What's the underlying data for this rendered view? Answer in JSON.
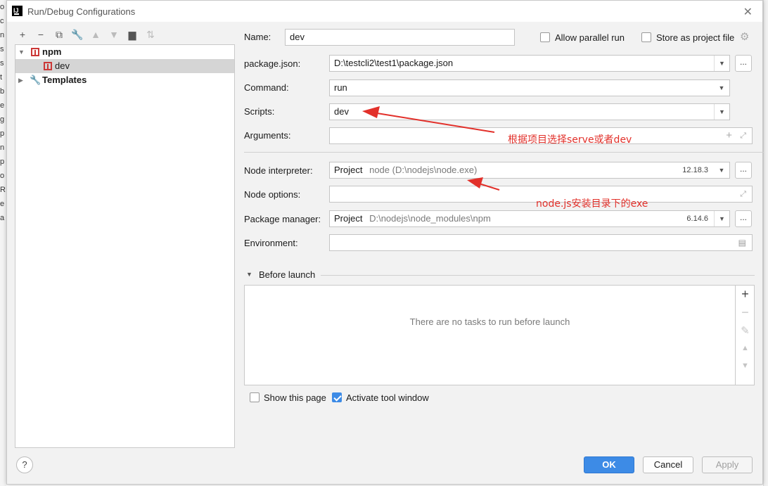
{
  "window": {
    "title": "Run/Debug Configurations",
    "app_icon": "IJ"
  },
  "toolbar": {
    "icons": [
      "plus-icon",
      "minus-icon",
      "copy-icon",
      "wrench-icon",
      "up-arrow-icon",
      "down-arrow-icon",
      "add-folder-icon",
      "sort-icon"
    ]
  },
  "tree": {
    "group_label": "npm",
    "config_label": "dev",
    "templates_label": "Templates"
  },
  "form": {
    "name_label": "Name:",
    "name_value": "dev",
    "allow_parallel_label": "Allow parallel run",
    "store_project_label": "Store as project file",
    "package_json_label": "package.json:",
    "package_json_value": "D:\\testcli2\\test1\\package.json",
    "command_label": "Command:",
    "command_value": "run",
    "scripts_label": "Scripts:",
    "scripts_value": "dev",
    "arguments_label": "Arguments:",
    "arguments_value": "",
    "node_interp_label": "Node interpreter:",
    "node_interp_project": "Project",
    "node_interp_path": "node (D:\\nodejs\\node.exe)",
    "node_interp_version": "12.18.3",
    "node_options_label": "Node options:",
    "node_options_value": "",
    "pkg_manager_label": "Package manager:",
    "pkg_manager_project": "Project",
    "pkg_manager_path": "D:\\nodejs\\node_modules\\npm",
    "pkg_manager_version": "6.14.6",
    "environment_label": "Environment:",
    "environment_value": "",
    "dots": "...",
    "dots2": "...",
    "dots3": "...",
    "dots4": "..."
  },
  "before_launch": {
    "label": "Before launch",
    "empty_text": "There are no tasks to run before launch"
  },
  "options": {
    "show_page_label": "Show this page",
    "show_page_checked": false,
    "activate_tool_label": "Activate tool window",
    "activate_tool_checked": true
  },
  "buttons": {
    "ok": "OK",
    "cancel": "Cancel",
    "apply": "Apply",
    "help": "?"
  },
  "annotations": {
    "scripts_note": "根据项目选择serve或者dev",
    "node_note": "node.js安装目录下的exe",
    "color": "#e2302a"
  },
  "colors": {
    "accent": "#3d8be6",
    "npm_red": "#cb3837"
  }
}
